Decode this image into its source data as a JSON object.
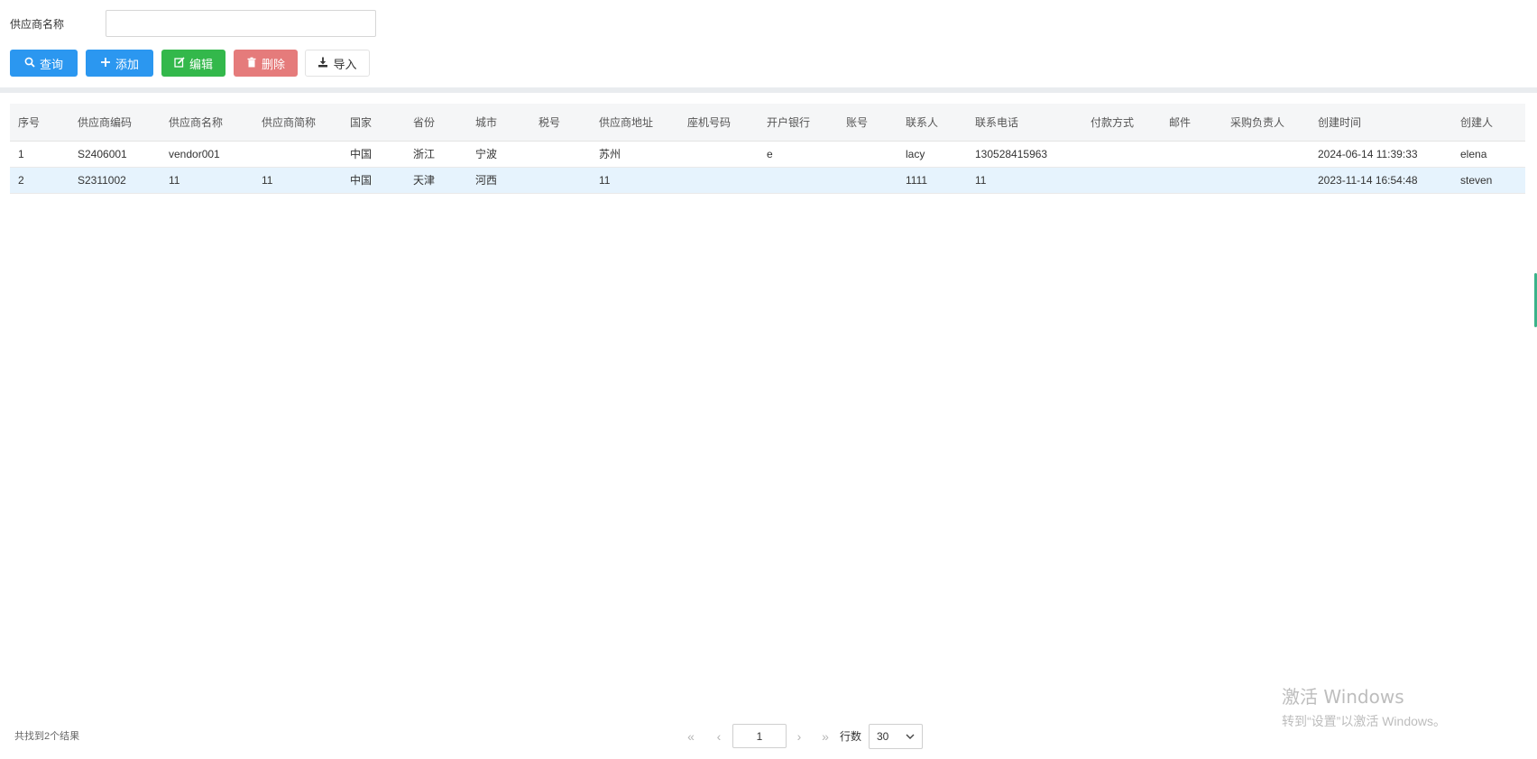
{
  "search": {
    "label": "供应商名称",
    "value": "",
    "placeholder": ""
  },
  "toolbar": {
    "query_label": "查询",
    "add_label": "添加",
    "edit_label": "编辑",
    "delete_label": "删除",
    "import_label": "导入"
  },
  "colors": {
    "primary": "#2b97f0",
    "success": "#33b84b",
    "danger": "#e57b7b",
    "selected_row": "#e6f3fd"
  },
  "table": {
    "columns": [
      "序号",
      "供应商编码",
      "供应商名称",
      "供应商简称",
      "国家",
      "省份",
      "城市",
      "税号",
      "供应商地址",
      "座机号码",
      "开户银行",
      "账号",
      "联系人",
      "联系电话",
      "付款方式",
      "邮件",
      "采购负责人",
      "创建时间",
      "创建人"
    ],
    "rows": [
      [
        "1",
        "S2406001",
        "vendor001",
        "",
        "中国",
        "浙江",
        "宁波",
        "",
        "苏州",
        "",
        "e",
        "",
        "lacy",
        "130528415963",
        "",
        "",
        "",
        "2024-06-14 11:39:33",
        "elena"
      ],
      [
        "2",
        "S2311002",
        "11",
        "11",
        "中国",
        "天津",
        "河西",
        "",
        "11",
        "",
        "",
        "",
        "1111",
        "11",
        "",
        "",
        "",
        "2023-11-14 16:54:48",
        "steven"
      ]
    ],
    "selected_row": 1
  },
  "footer": {
    "count_text": "共找到2个结果"
  },
  "pager": {
    "first": "«",
    "prev": "‹",
    "page": "1",
    "next": "›",
    "last": "»",
    "rows_label": "行数",
    "rows_value": "30"
  },
  "watermark": {
    "title": "激活 Windows",
    "subtitle": "转到“设置”以激活 Windows。"
  }
}
